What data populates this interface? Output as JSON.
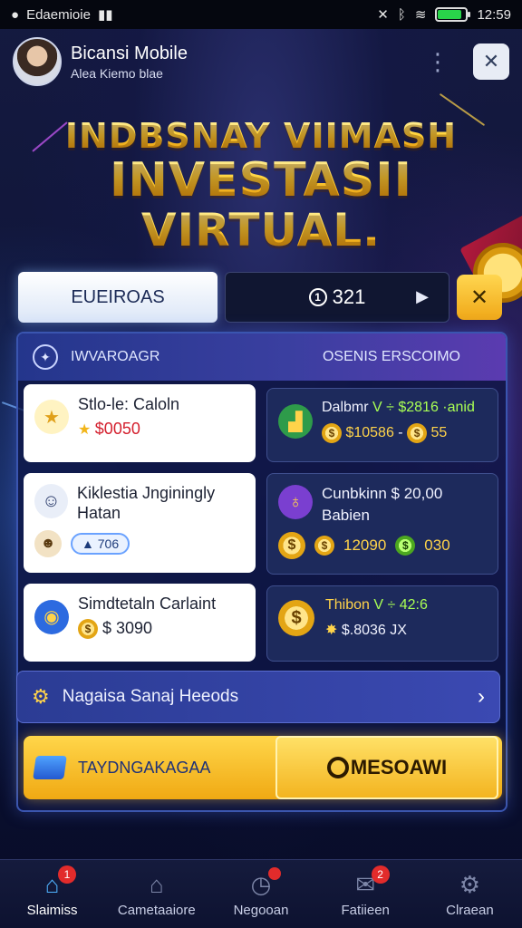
{
  "status_bar": {
    "left_text": "Edaemioie",
    "time": "12:59"
  },
  "header": {
    "app_name": "Bicansi Mobile",
    "subtitle": "Alea Kiemo blae",
    "more_icon": "more-vertical-icon",
    "close_icon": "close-icon"
  },
  "hero": {
    "line1": "INDBSNAY VIIMASH",
    "line2": "INVESTASII",
    "line3": "VIRTUAL."
  },
  "tabs": {
    "primary_label": "EUEIROAS",
    "counter_value": "321",
    "counter_icon": "①"
  },
  "panel": {
    "header_left": "IWVAROAGR",
    "header_right": "OSENIS ERSCOIMO",
    "left_cards": [
      {
        "title": "Stlo-le: Caloln",
        "price": "$0050",
        "icon": "star-coin-icon"
      },
      {
        "title": "Kiklestia Jnginingly Hatan",
        "chip": "706",
        "icon": "person-icon"
      },
      {
        "title": "Simdtetaln Carlaint",
        "price": "$ 3090",
        "icon": "globe-icon"
      }
    ],
    "right_cards": [
      {
        "line1": "Dalbmr",
        "line1_highlight": "V ÷ $2816 ·anid",
        "line2": "$10586",
        "line2_suffix": "55",
        "icon": "chart-icon"
      },
      {
        "line1": "Cunbkinn $ 20,00",
        "line2": "Babien",
        "coin_a": "12090",
        "coin_b": "030",
        "icon": "planet-icon"
      },
      {
        "line1": "Thibon",
        "line1_highlight": "V ÷ 42:6",
        "line2": "$.8036",
        "line2_suffix": "JX",
        "icon": "dollar-coin-icon"
      }
    ],
    "nav_label": "Nagaisa Sanaj Heeods",
    "cta_left": "TAYDNGAKAGAA",
    "cta_right": "MESOAWI"
  },
  "bottom_nav": [
    {
      "label": "Slaimiss",
      "icon": "home-icon",
      "active": true,
      "badge": "1"
    },
    {
      "label": "Cametaaiore",
      "icon": "house-chart-icon",
      "active": false
    },
    {
      "label": "Negooan",
      "icon": "clock-icon",
      "active": false,
      "badge": ""
    },
    {
      "label": "Fatiieen",
      "icon": "inbox-icon",
      "active": false,
      "badge": "2"
    },
    {
      "label": "Clraean",
      "icon": "gear-icon",
      "active": false
    }
  ],
  "colors": {
    "accent_gold": "#ffd34a",
    "accent_blue": "#4fb2ff",
    "price_red": "#d4202e",
    "badge_red": "#e22b2b"
  }
}
